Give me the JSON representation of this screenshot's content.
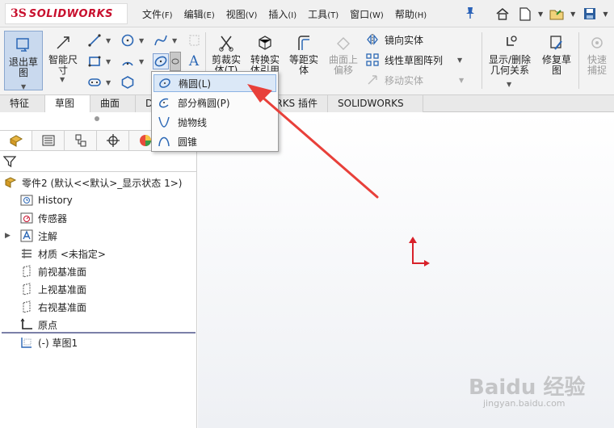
{
  "app": {
    "brand": "SOLIDWORKS",
    "logo_mark": "3S"
  },
  "menu": [
    {
      "label": "文件",
      "hotkey": "(F)"
    },
    {
      "label": "编辑",
      "hotkey": "(E)"
    },
    {
      "label": "视图",
      "hotkey": "(V)"
    },
    {
      "label": "插入",
      "hotkey": "(I)"
    },
    {
      "label": "工具",
      "hotkey": "(T)"
    },
    {
      "label": "窗口",
      "hotkey": "(W)"
    },
    {
      "label": "帮助",
      "hotkey": "(H)"
    }
  ],
  "ribbon": {
    "exit_sketch": "退出草图",
    "smart_dimension": "智能尺寸",
    "trim_entities": "剪裁实体(T)",
    "convert_entities": "转换实体引用",
    "offset_entities": "等距实体",
    "offset_on_surface": "曲面上偏移",
    "mirror_entities": "镜向实体",
    "linear_pattern": "线性草图阵列",
    "move_entities": "移动实体",
    "display_delete_relations": "显示/删除几何关系",
    "repair_sketch": "修复草图",
    "quick_snaps": "快速捕捉"
  },
  "tabs": [
    "特征",
    "草图",
    "曲面",
    "DimXpert",
    "SOLIDWORKS 插件",
    "SOLIDWORKS MBD"
  ],
  "active_tab": "草图",
  "feature_tree": {
    "root": "零件2 (默认<<默认>_显示状态 1>)",
    "items": [
      "History",
      "传感器",
      "注解",
      "材质 <未指定>",
      "前视基准面",
      "上视基准面",
      "右视基准面",
      "原点",
      "(-) 草图1"
    ]
  },
  "flyout": {
    "items": [
      {
        "label": "椭圆(L)",
        "icon": "ellipse-icon"
      },
      {
        "label": "部分椭圆(P)",
        "icon": "partial-ellipse-icon"
      },
      {
        "label": "抛物线",
        "icon": "parabola-icon"
      },
      {
        "label": "圆锥",
        "icon": "conic-icon"
      }
    ],
    "highlighted": "椭圆(L)"
  },
  "watermark": {
    "main": "Baidu 经验",
    "sub": "jingyan.baidu.com"
  },
  "colors": {
    "accent": "#2b67b5",
    "brand": "#c8102e",
    "annotation_arrow": "#e8403a",
    "origin": "#d8212a"
  }
}
